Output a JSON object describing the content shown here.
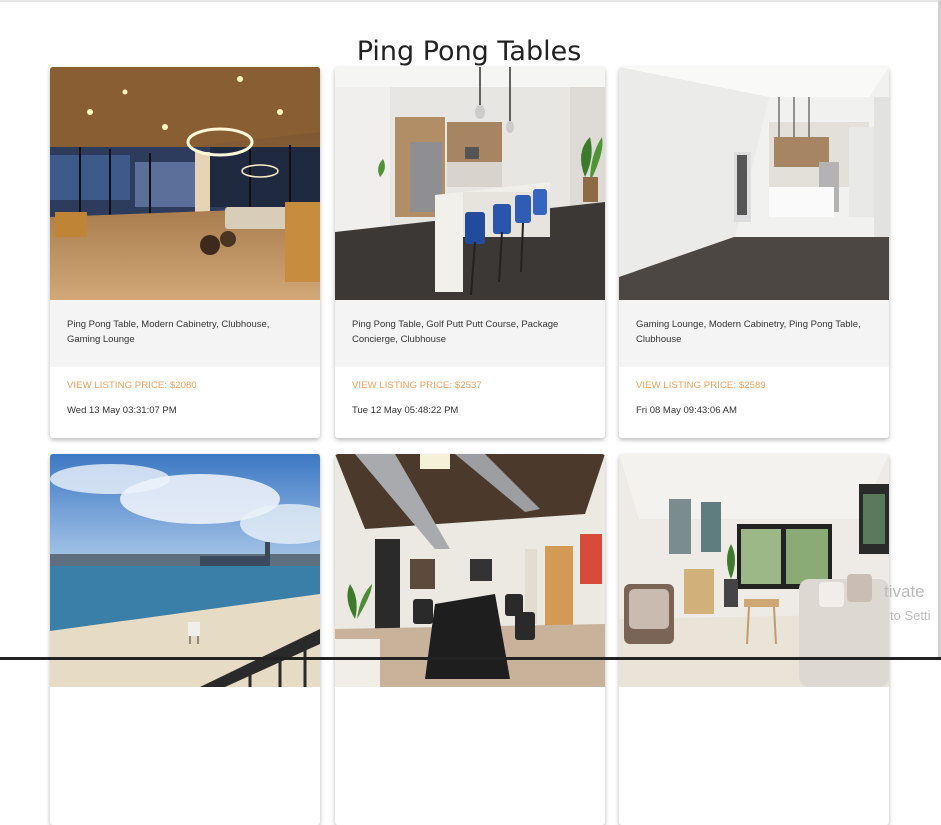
{
  "page": {
    "title": "Ping Pong Tables"
  },
  "listings": [
    {
      "tags": "Ping Pong Table, Modern Cabinetry, Clubhouse, Gaming Lounge",
      "price_label": "VIEW LISTING PRICE: $2080",
      "date": "Wed 13 May 03:31:07 PM",
      "photo_icon": "clubhouse-lounge-photo"
    },
    {
      "tags": "Ping Pong Table, Golf Putt Putt Course, Package Concierge, Clubhouse",
      "price_label": "VIEW LISTING PRICE: $2537",
      "date": "Tue 12 May 05:48:22 PM",
      "photo_icon": "kitchen-photo"
    },
    {
      "tags": "Gaming Lounge, Modern Cabinetry, Ping Pong Table, Clubhouse",
      "price_label": "VIEW LISTING PRICE: $2589",
      "date": "Fri 08 May 09:43:06 AM",
      "photo_icon": "empty-apartment-photo"
    },
    {
      "photo_icon": "beach-balcony-photo"
    },
    {
      "photo_icon": "conference-room-photo"
    },
    {
      "photo_icon": "living-room-photo"
    }
  ],
  "watermark": {
    "line1": "tivate",
    "line2": "to Setti"
  },
  "colors": {
    "price_accent": "#f0a15a",
    "tags_background": "#f4f4f4"
  }
}
